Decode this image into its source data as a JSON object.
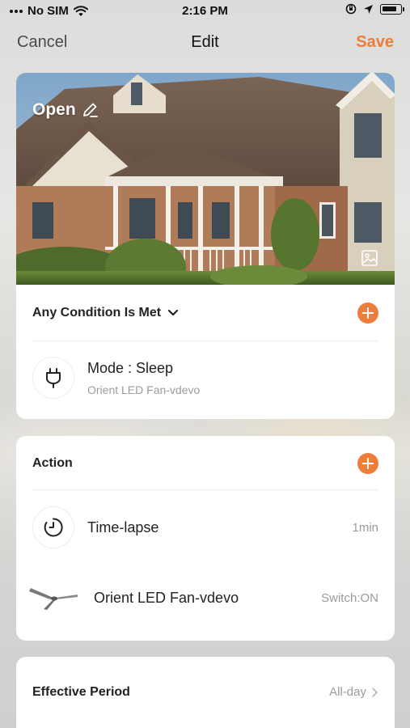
{
  "status_bar": {
    "carrier": "No SIM",
    "time": "2:16 PM",
    "icons": [
      "wifi-icon",
      "orientation-lock-icon",
      "location-icon",
      "battery-icon"
    ]
  },
  "nav": {
    "cancel_label": "Cancel",
    "title": "Edit",
    "save_label": "Save"
  },
  "cover": {
    "label": "Open",
    "edit_icon": "pencil-icon",
    "change_image_icon": "image-icon"
  },
  "conditions": {
    "header": "Any Condition Is Met",
    "items": [
      {
        "icon": "plug-icon",
        "title": "Mode : Sleep",
        "subtitle": "Orient LED Fan-vdevo"
      }
    ]
  },
  "actions": {
    "header": "Action",
    "items": [
      {
        "icon": "timer-icon",
        "title": "Time-lapse",
        "value": "1min"
      },
      {
        "icon": "ceiling-fan-icon",
        "title": "Orient LED Fan-vdevo",
        "value": "Switch:ON"
      }
    ]
  },
  "effective_period": {
    "label": "Effective Period",
    "value": "All-day"
  },
  "colors": {
    "accent": "#ed7d3a",
    "card_bg": "#ffffff",
    "secondary_text": "#9b9b9b"
  }
}
